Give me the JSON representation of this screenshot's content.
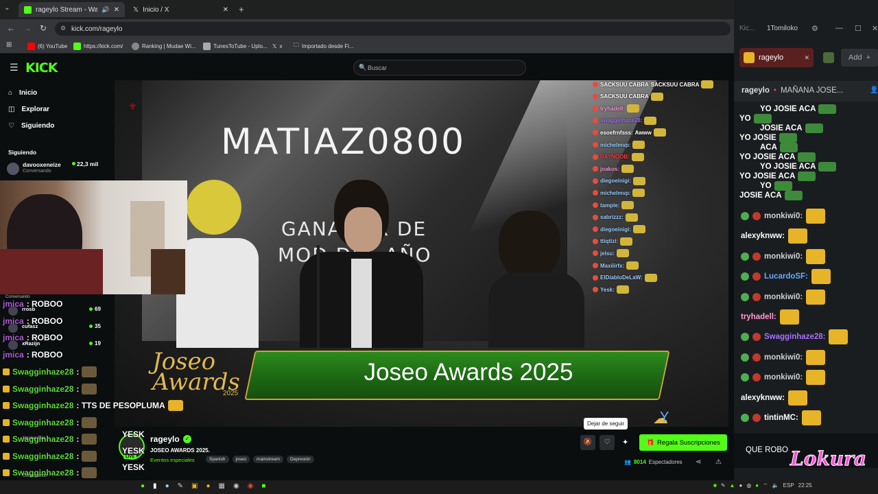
{
  "browser": {
    "tabs": [
      {
        "label": "rageylo Stream - Watch Liv",
        "active": true
      },
      {
        "label": "Inicio / X",
        "active": false
      }
    ],
    "url": "kick.com/rageylo",
    "bookmarks": [
      "(6) YouTube",
      "https://kick.com/",
      "Ranking | Mudae Wi...",
      "TunesToTube - Uplo...",
      "x",
      "Importado desde Fi..."
    ]
  },
  "kick": {
    "logo": "KICK",
    "search_placeholder": "Buscar",
    "nav": [
      "Inicio",
      "Explorar",
      "Siguiendo"
    ],
    "following_title": "Siguiendo",
    "following": [
      {
        "name": "davooxeneize",
        "status": "Conversando",
        "viewers": "22,3 mil"
      },
      {
        "name": "rrosb",
        "viewers": "69"
      },
      {
        "name": "cufasz",
        "viewers": "35"
      },
      {
        "name": "xRazijn",
        "viewers": "19"
      }
    ],
    "conversando_label": "Conversando",
    "mostrar_mas": "Mostrar Más"
  },
  "video": {
    "screen_title": "MATIAZ0800",
    "screen_subtitle_1": "GANADOR DE",
    "screen_subtitle_2": "MOD DEL AÑO",
    "awards_logo_line1": "Joseo",
    "awards_logo_line2": "Awards",
    "awards_logo_year": "2025",
    "banner_text": "Joseo Awards 2025"
  },
  "overlay_chat_left": [
    {
      "user": "jmica",
      "text": ": ROBOO",
      "color": "#b05cd9"
    },
    {
      "user": "jmica",
      "text": ": ROBOO",
      "color": "#b05cd9"
    },
    {
      "user": "jmica",
      "text": ": ROBOO",
      "color": "#b05cd9"
    },
    {
      "user": "jmica",
      "text": ": ROBOO",
      "color": "#b05cd9"
    },
    {
      "user": "Swagginhaze28",
      "text": ":",
      "color": "#5cdb3b"
    },
    {
      "user": "Swagginhaze28",
      "text": ":",
      "color": "#5cdb3b"
    },
    {
      "user": "Swagginhaze28",
      "text": ": TTS DE PESOPLUMA",
      "color": "#5cdb3b"
    },
    {
      "user": "Swagginhaze28",
      "text": ":",
      "color": "#5cdb3b"
    },
    {
      "user": "Swagginhaze28",
      "text": ":",
      "color": "#5cdb3b"
    },
    {
      "user": "Swagginhaze28",
      "text": ":",
      "color": "#5cdb3b"
    },
    {
      "user": "Swagginhaze28",
      "text": ":",
      "color": "#5cdb3b"
    }
  ],
  "yesk": [
    "YESK",
    "YESK",
    "YESK",
    "YESK"
  ],
  "overlay_chat_video": [
    {
      "user": "SACKSUU CABRA",
      "text": "SACKSUU CABRA",
      "color": "#ffffff"
    },
    {
      "user": "SACKSUU CABRA",
      "text": "",
      "color": "#ffffff"
    },
    {
      "user": "tryhadell:",
      "text": "",
      "color": "#ff9ad5"
    },
    {
      "user": "swagginhaze28:",
      "text": "",
      "color": "#a870ff"
    },
    {
      "user": "esoefrnfsss:",
      "text": "Awww",
      "color": "#ffffff"
    },
    {
      "user": "michelmvp:",
      "text": "",
      "color": "#9ad0ff"
    },
    {
      "user": "RAYNOOB:",
      "text": "",
      "color": "#ff3b3b"
    },
    {
      "user": "joakos:",
      "text": "",
      "color": "#ff9ad5"
    },
    {
      "user": "diegoeinigi:",
      "text": "",
      "color": "#9ad0ff"
    },
    {
      "user": "michelmvp:",
      "text": "",
      "color": "#9ad0ff"
    },
    {
      "user": "tample:",
      "text": "",
      "color": "#9ad0ff"
    },
    {
      "user": "sabrizzz:",
      "text": "",
      "color": "#9ad0ff"
    },
    {
      "user": "diegoeinigi:",
      "text": "",
      "color": "#9ad0ff"
    },
    {
      "user": "ttiqtizi:",
      "text": "",
      "color": "#9ad0ff"
    },
    {
      "user": "jelsu:",
      "text": "",
      "color": "#9ad0ff"
    },
    {
      "user": "Maxiiirfx:",
      "text": "",
      "color": "#9ad0ff"
    },
    {
      "user": "ElDiabloDeLaW:",
      "text": "",
      "color": "#9ad0ff"
    },
    {
      "user": "Yesk:",
      "text": "",
      "color": "#9ad0ff"
    }
  ],
  "stream": {
    "channel": "rageylo",
    "title": "JOSEO AWARDS 2025.",
    "category": "Eventos especiales",
    "tags": [
      "Spanish",
      "joseo",
      "mainstream",
      "Depresión"
    ],
    "viewers": "8014",
    "viewers_label": "Espectadores",
    "tooltip": "Dejar de seguir",
    "subscribe_button": "Regala Suscripciones",
    "live_badge": "LIVE"
  },
  "right_panel": {
    "tab_kick": "Kic...",
    "tab_user": "1Tomiloko",
    "channel_chip": "rageylo",
    "add_button": "Add",
    "pinned_user": "rageylo",
    "pinned_text": "MAÑANA JOSE...",
    "chat_input": "QUE ROBO",
    "watermark": "Lokura",
    "spam_line": "YO JOSIE ACA",
    "spam_lines": [
      "YO JOSIE ACA",
      "YO",
      "JOSIE ACA",
      "YO JOSIE",
      "ACA",
      "YO JOSIE ACA",
      "YO JOSIE ACA",
      "YO JOSIE ACA",
      "YO",
      "JOSIE ACA"
    ],
    "messages": [
      {
        "user": "monkiwi0:",
        "color": "#d0d0d0"
      },
      {
        "user": "alexyknww:",
        "color": "#ffffff"
      },
      {
        "user": "monkiwi0:",
        "color": "#d0d0d0"
      },
      {
        "user": "LucardoSF:",
        "color": "#6aa8ff"
      },
      {
        "user": "monkiwi0:",
        "color": "#d0d0d0"
      },
      {
        "user": "tryhadell:",
        "color": "#ff9ad5"
      },
      {
        "user": "Swagginhaze28:",
        "color": "#a870ff"
      },
      {
        "user": "monkiwi0:",
        "color": "#d0d0d0"
      },
      {
        "user": "monkiwi0:",
        "color": "#d0d0d0"
      },
      {
        "user": "alexyknww:",
        "color": "#ffffff"
      },
      {
        "user": "tintinMC:",
        "color": "#ffffff"
      }
    ]
  },
  "taskbar": {
    "lang": "ESP",
    "time": "22:25"
  },
  "colors": {
    "kick_green": "#53fc18",
    "banner_green": "#1e7a1e",
    "pink": "#ff4fd8"
  }
}
